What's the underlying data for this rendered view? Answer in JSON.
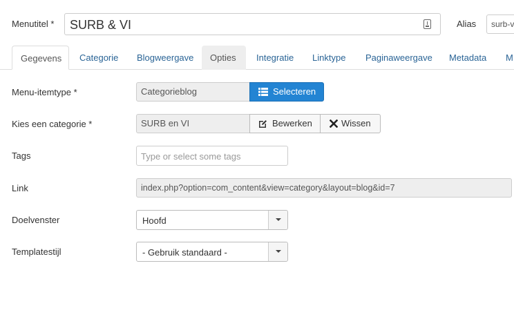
{
  "header": {
    "title_label": "Menutitel *",
    "title_value": "SURB & VI",
    "alias_label": "Alias",
    "alias_value": "surb-v"
  },
  "tabs": [
    {
      "label": "Gegevens",
      "state": "active"
    },
    {
      "label": "Categorie",
      "state": "normal"
    },
    {
      "label": "Blogweergave",
      "state": "normal"
    },
    {
      "label": "Opties",
      "state": "hover"
    },
    {
      "label": "Integratie",
      "state": "normal"
    },
    {
      "label": "Linktype",
      "state": "normal"
    },
    {
      "label": "Paginaweergave",
      "state": "normal"
    },
    {
      "label": "Metadata",
      "state": "normal"
    },
    {
      "label": "M",
      "state": "normal"
    }
  ],
  "form": {
    "menu_itemtype": {
      "label": "Menu-itemtype *",
      "value": "Categorieblog",
      "select_button": "Selecteren",
      "select_icon": "list-icon"
    },
    "category": {
      "label": "Kies een categorie *",
      "value": "SURB en VI",
      "edit_button": "Bewerken",
      "edit_icon": "edit-icon",
      "clear_button": "Wissen",
      "clear_icon": "close-icon"
    },
    "tags": {
      "label": "Tags",
      "placeholder": "Type or select some tags"
    },
    "link": {
      "label": "Link",
      "value": "index.php?option=com_content&view=category&layout=blog&id=7"
    },
    "target_window": {
      "label": "Doelvenster",
      "value": "Hoofd"
    },
    "template_style": {
      "label": "Templatestijl",
      "value": "- Gebruik standaard -"
    }
  },
  "colors": {
    "primary_button": "#2384d3",
    "tab_link": "#2a6496",
    "field_background": "#eeeeee"
  }
}
